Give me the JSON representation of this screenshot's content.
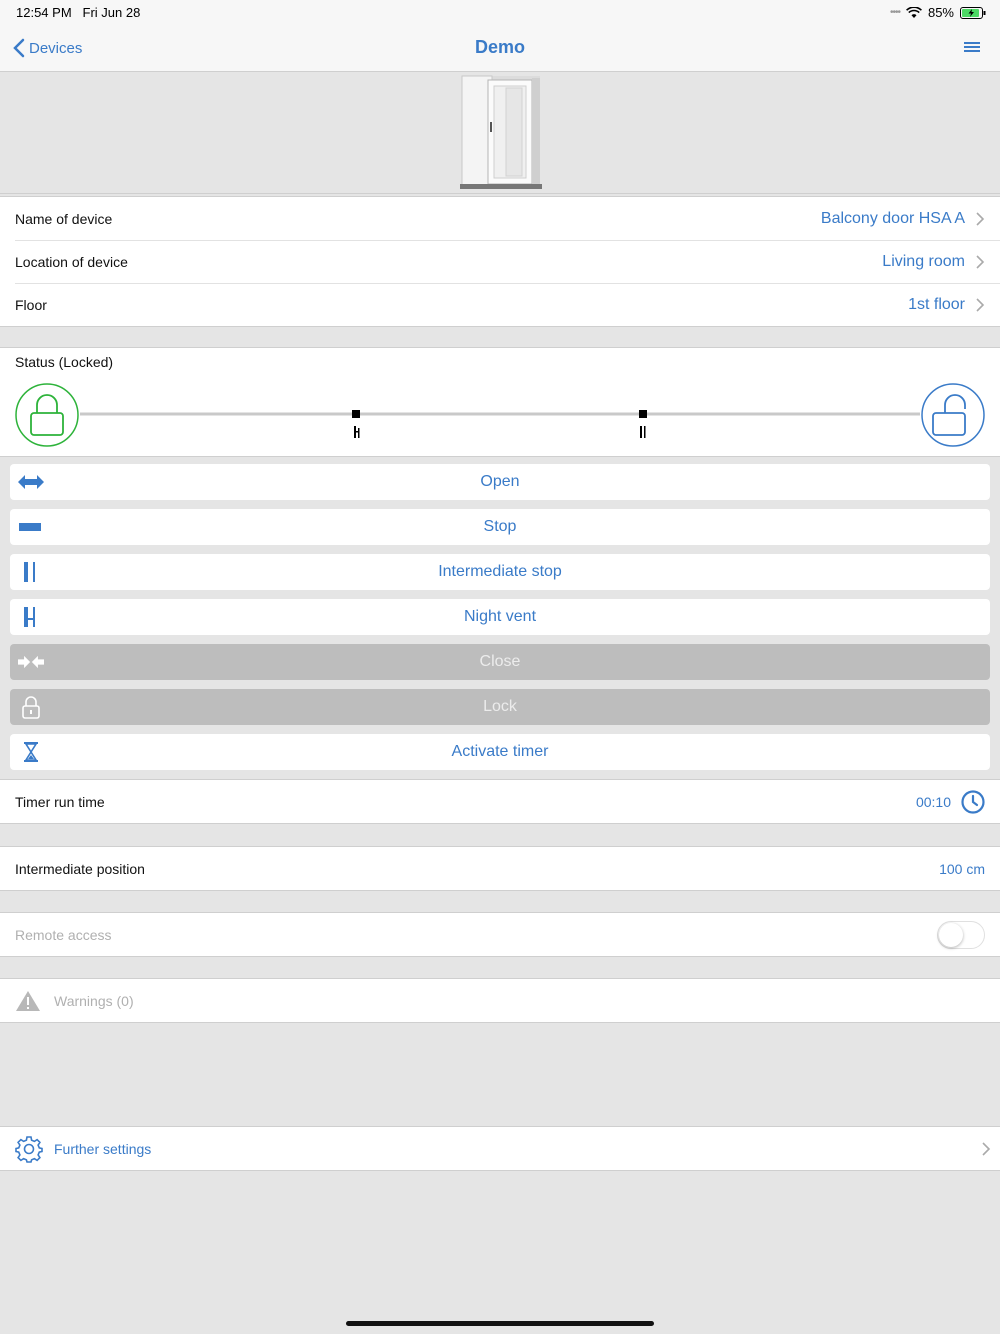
{
  "status_bar": {
    "time": "12:54 PM",
    "date": "Fri Jun 28",
    "battery": "85%"
  },
  "nav": {
    "back_label": "Devices",
    "title": "Demo"
  },
  "device_rows": [
    {
      "label": "Name of device",
      "value": "Balcony door HSA A"
    },
    {
      "label": "Location of device",
      "value": "Living room"
    },
    {
      "label": "Floor",
      "value": "1st floor"
    }
  ],
  "status": {
    "label": "Status (Locked)"
  },
  "actions": [
    {
      "label": "Open",
      "icon": "double-arrow-icon",
      "enabled": true
    },
    {
      "label": "Stop",
      "icon": "stop-bar-icon",
      "enabled": true
    },
    {
      "label": "Intermediate stop",
      "icon": "intermediate-stop-icon",
      "enabled": true
    },
    {
      "label": "Night vent",
      "icon": "night-vent-icon",
      "enabled": true
    },
    {
      "label": "Close",
      "icon": "close-arrows-icon",
      "enabled": false
    },
    {
      "label": "Lock",
      "icon": "lock-icon",
      "enabled": false
    },
    {
      "label": "Activate timer",
      "icon": "hourglass-icon",
      "enabled": true
    }
  ],
  "timer": {
    "label": "Timer run time",
    "value": "00:10"
  },
  "intermediate": {
    "label": "Intermediate position",
    "value": "100 cm"
  },
  "remote": {
    "label": "Remote access",
    "enabled": false
  },
  "warnings": {
    "label": "Warnings (0)"
  },
  "further": {
    "label": "Further settings"
  },
  "colors": {
    "accent": "#3a7bc8",
    "locked": "#2db33a",
    "disabled": "#bdbdbd"
  }
}
